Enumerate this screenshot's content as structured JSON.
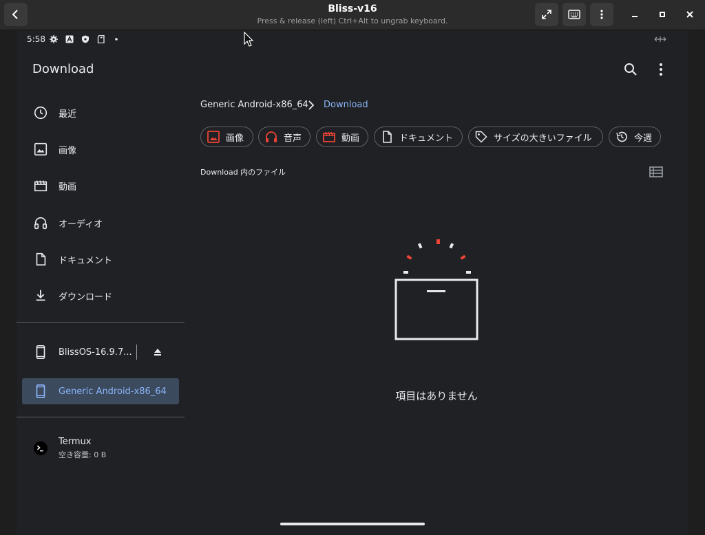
{
  "window": {
    "title": "Bliss-v16",
    "subtitle": "Press & release (left) Ctrl+Alt to ungrab keyboard."
  },
  "statusbar": {
    "time": "5:58"
  },
  "appbar": {
    "title": "Download"
  },
  "drawer": {
    "items": [
      {
        "label": "最近",
        "icon": "clock-icon"
      },
      {
        "label": "画像",
        "icon": "image-icon"
      },
      {
        "label": "動画",
        "icon": "movie-icon"
      },
      {
        "label": "オーディオ",
        "icon": "headphones-icon"
      },
      {
        "label": "ドキュメント",
        "icon": "document-icon"
      },
      {
        "label": "ダウンロード",
        "icon": "download-icon"
      }
    ],
    "devices": [
      {
        "label": "BlissOS-16.9.7...",
        "icon": "phone-icon"
      },
      {
        "label": "Generic Android-x86_64",
        "icon": "phone-icon",
        "selected": true
      }
    ],
    "apps": [
      {
        "label": "Termux",
        "sublabel": "空き容量: 0 B",
        "icon": "terminal-icon"
      }
    ]
  },
  "breadcrumb": {
    "root": "Generic Android-x86_64",
    "current": "Download"
  },
  "chips": [
    {
      "label": "画像",
      "icon": "image-icon"
    },
    {
      "label": "音声",
      "icon": "headphones-icon"
    },
    {
      "label": "動画",
      "icon": "movie-icon"
    },
    {
      "label": "ドキュメント",
      "icon": "document-icon"
    },
    {
      "label": "サイズの大きいファイル",
      "icon": "tag-icon"
    },
    {
      "label": "今週",
      "icon": "history-icon"
    }
  ],
  "section_label": "Download 内のファイル",
  "empty_message": "項目はありません",
  "colors": {
    "accent_blue": "#8ab4f8",
    "accent_red": "#ea4335",
    "background": "#202124",
    "text": "#e8eaed"
  }
}
